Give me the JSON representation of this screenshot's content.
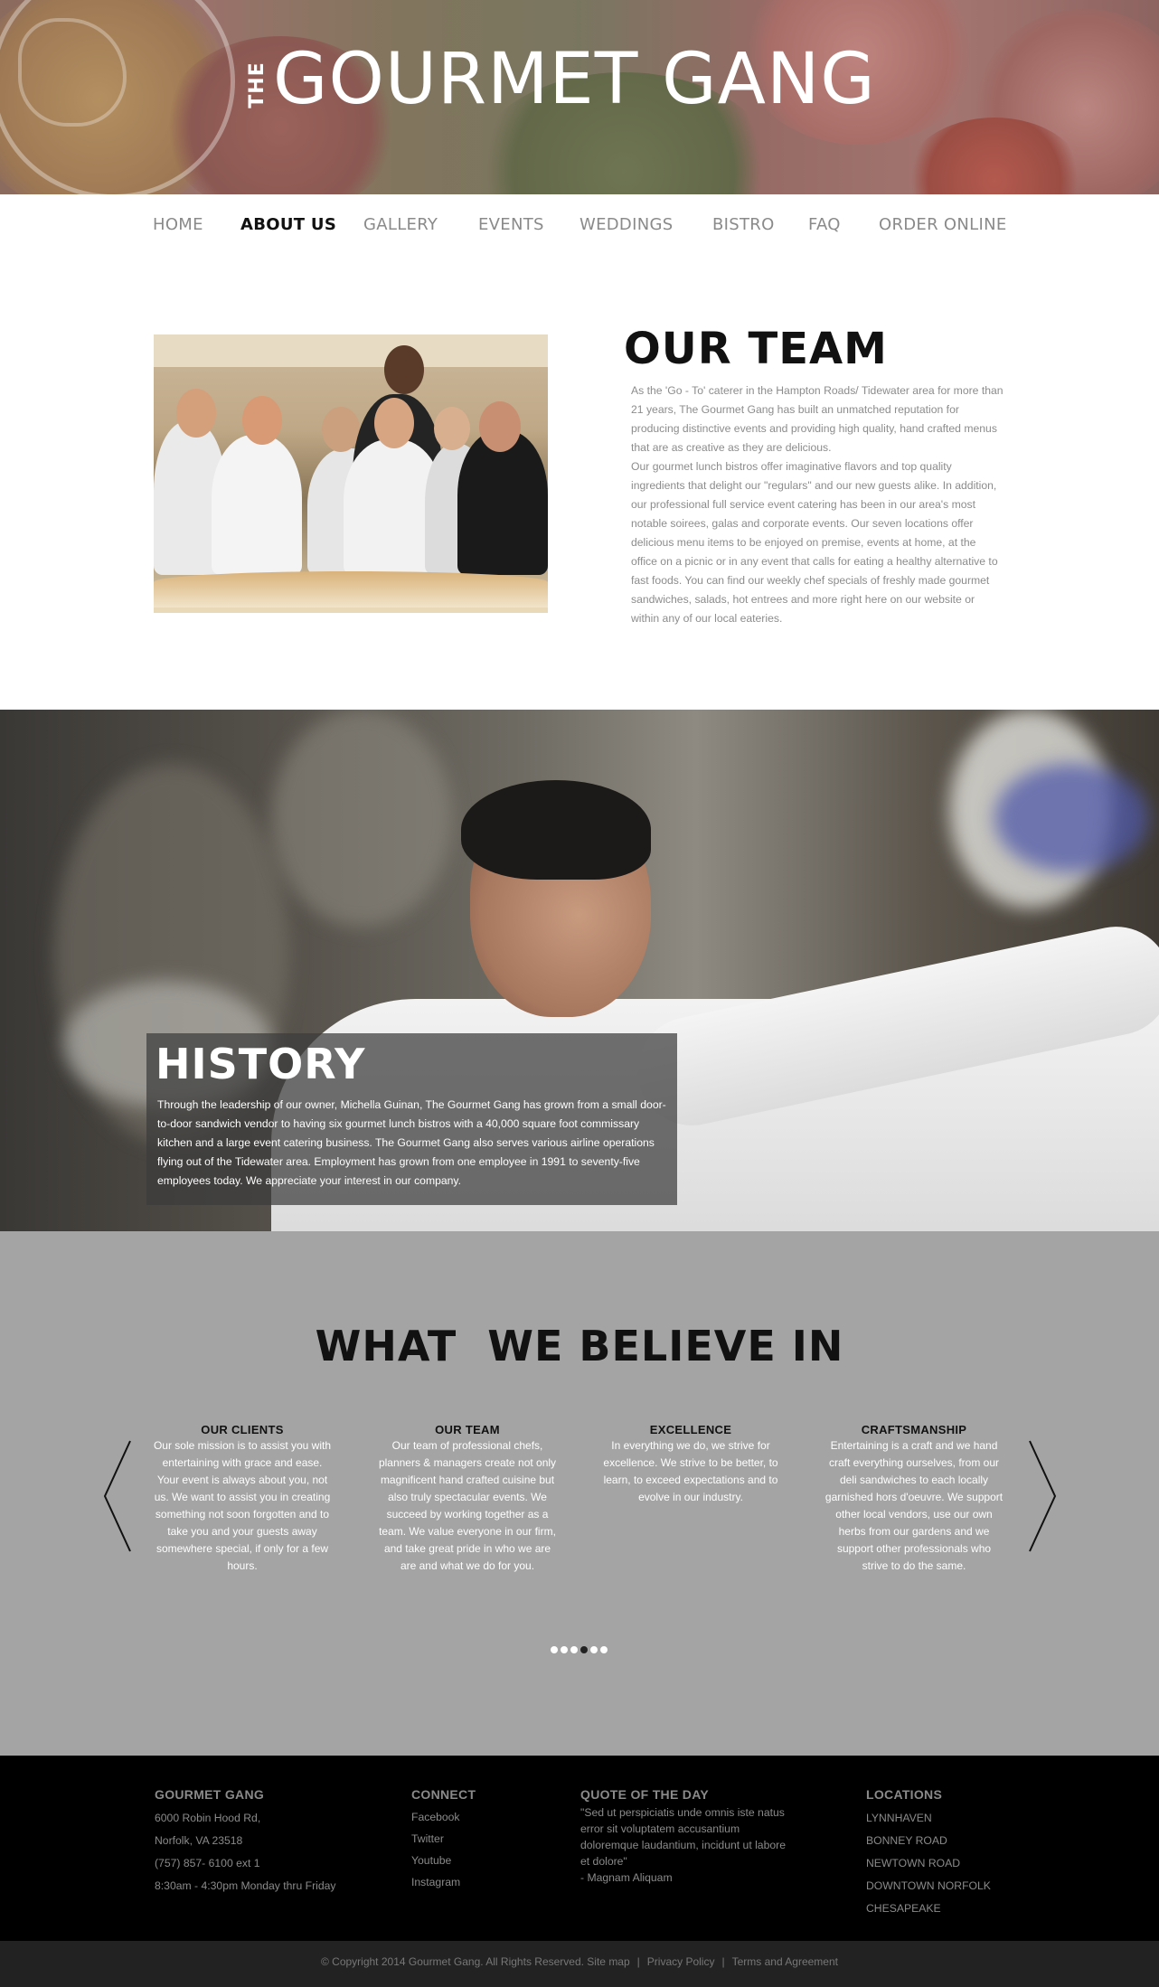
{
  "brand": {
    "logo_prefix": "THE",
    "logo_main": "GOURMET GANG"
  },
  "nav": {
    "items": [
      {
        "label": "HOME",
        "active": false
      },
      {
        "label": "ABOUT US",
        "active": true
      },
      {
        "label": "GALLERY",
        "active": false
      },
      {
        "label": "EVENTS",
        "active": false
      },
      {
        "label": "WEDDINGS",
        "active": false
      },
      {
        "label": "BISTRO",
        "active": false
      },
      {
        "label": "FAQ",
        "active": false
      },
      {
        "label": "ORDER ONLINE",
        "active": false
      }
    ]
  },
  "team": {
    "title": "OUR TEAM",
    "paragraph1": "As the 'Go - To' caterer in the Hampton Roads/ Tidewater area for more than 21 years, The Gourmet Gang has built an unmatched reputation for producing distinctive events and providing high quality, hand crafted menus that are as creative as they are delicious.",
    "paragraph2": "Our gourmet lunch bistros offer imaginative flavors and top quality ingredients that delight our \"regulars\" and our new guests alike. In addition, our professional full service event catering has been in our area's most notable soirees, galas and corporate events. Our seven locations offer delicious menu items to be enjoyed on premise, events at home, at the office on a picnic or in any event that calls for eating a healthy alternative to fast foods. You can find our weekly chef specials of freshly made gourmet sandwiches, salads, hot entrees and more right here on our website or within any of our local eateries."
  },
  "history": {
    "title": "HISTORY",
    "text": "Through the leadership of our owner, Michella Guinan, The Gourmet Gang has grown from a small door-to-door sandwich vendor to having six gourmet lunch bistros with a 40,000 square foot commissary kitchen and a large event catering business. The Gourmet Gang also serves various airline operations flying out of the Tidewater area. Employment has grown from one employee in 1991 to seventy-five employees today. We appreciate your interest in our company."
  },
  "beliefs": {
    "title": "WHAT  WE BELIEVE IN",
    "items": [
      {
        "heading": "OUR CLIENTS",
        "text": "Our sole mission is to assist you with entertaining with grace and ease. Your event is always about you, not us. We want to assist you in creating something not soon forgotten and to take you and your guests away somewhere special, if only for a few hours."
      },
      {
        "heading": "OUR TEAM",
        "text": "Our team of professional chefs, planners & managers create not only magnificent hand crafted cuisine but also truly spectacular events. We succeed by working together as a team. We value everyone in our firm, and take great pride in who we are are and what we do for you."
      },
      {
        "heading": "EXCELLENCE",
        "text": "In everything we do, we strive for excellence. We strive to be better, to learn, to exceed expectations and to evolve in our industry."
      },
      {
        "heading": "CRAFTSMANSHIP",
        "text": "Entertaining is a craft and we hand craft everything ourselves, from our deli sandwiches to each locally garnished hors d'oeuvre. We support other local vendors, use our own herbs from our gardens and we support other professionals who strive to do the same."
      }
    ],
    "carousel_active_index": 3,
    "carousel_count": 6
  },
  "footer": {
    "company": {
      "heading": "GOURMET GANG",
      "lines": [
        "6000 Robin Hood Rd,",
        "Norfolk, VA 23518",
        "(757) 857- 6100 ext 1",
        "8:30am - 4:30pm Monday thru Friday"
      ]
    },
    "connect": {
      "heading": "CONNECT",
      "links": [
        "Facebook",
        "Twitter",
        "Youtube",
        "Instagram"
      ]
    },
    "quote": {
      "heading": "QUOTE OF THE DAY",
      "text": "\"Sed ut perspiciatis unde omnis iste natus error sit voluptatem accusantium doloremque laudantium, incidunt ut labore et dolore\"",
      "author": "- Magnam Aliquam"
    },
    "locations": {
      "heading": "LOCATIONS",
      "items": [
        "LYNNHAVEN",
        "BONNEY ROAD",
        "NEWTOWN ROAD",
        "DOWNTOWN NORFOLK",
        "CHESAPEAKE"
      ]
    },
    "copyright": "© Copyright 2014 Gourmet Gang. All Rights Reserved. Site map",
    "privacy": "Privacy Policy",
    "terms": "Terms and Agreement",
    "separator": "|"
  },
  "colors": {
    "beliefs_bg": "#a4a4a4",
    "footer_bg": "#000000",
    "bottom_bar_bg": "#222222",
    "text_muted": "#8c8c8c"
  }
}
